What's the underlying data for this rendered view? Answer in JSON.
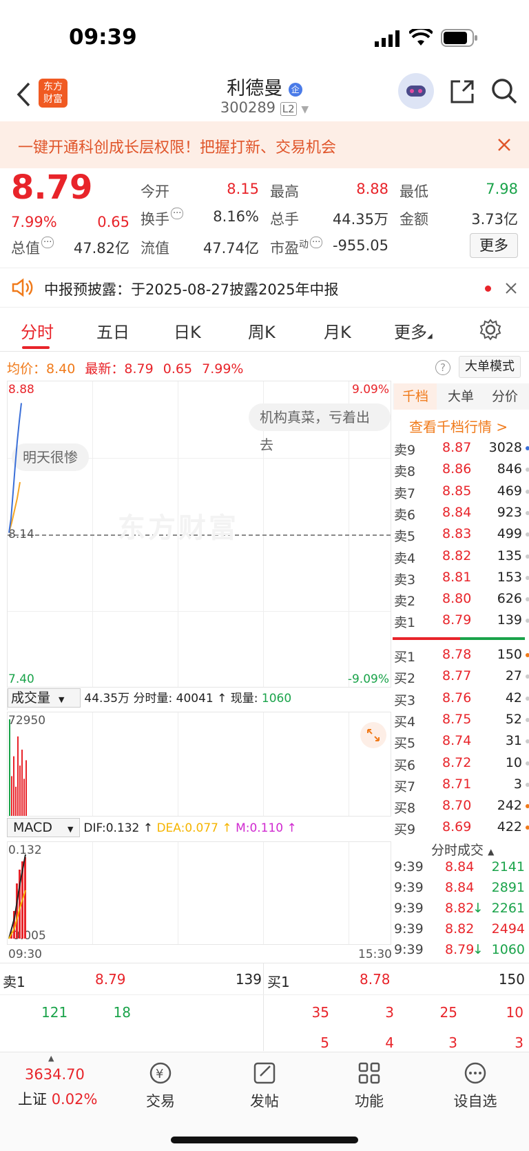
{
  "status_bar": {
    "time": "09:39"
  },
  "header": {
    "stock_name": "利德曼",
    "badge": "企",
    "stock_code": "300289",
    "level": "L2"
  },
  "banner": {
    "text": "一键开通科创成长层权限！把握打新、交易机会"
  },
  "quote": {
    "price": "8.79",
    "change_pct": "7.99%",
    "change": "0.65",
    "open_label": "今开",
    "open": "8.15",
    "high_label": "最高",
    "high": "8.88",
    "low_label": "最低",
    "low": "7.98",
    "turnover_label": "换手",
    "turnover": "8.16%",
    "volume_label": "总手",
    "volume": "44.35万",
    "amount_label": "金额",
    "amount": "3.73亿",
    "mktcap_label": "总值",
    "mktcap": "47.82亿",
    "float_label": "流值",
    "float": "47.74亿",
    "pe_label": "市盈",
    "pe_sup": "动",
    "pe": "-955.05",
    "more_button": "更多"
  },
  "notice": {
    "text": "中报预披露：于2025-08-27披露2025年中报"
  },
  "tabs": [
    "分时",
    "五日",
    "日K",
    "周K",
    "月K",
    "更多"
  ],
  "chart_info": {
    "avg_label": "均价：",
    "avg": "8.40",
    "latest_label": "最新：",
    "latest": "8.79",
    "latest_chg": "0.65",
    "latest_pct": "7.99%",
    "large_order_mode": "大单模式",
    "comment_1": "机构真菜，亏着出去",
    "comment_2": "明天很惨",
    "watermark": "东方财富"
  },
  "chart_data": {
    "type": "line",
    "y_top": "8.88",
    "y_mid": "8.14",
    "y_bottom": "7.40",
    "pct_top": "9.09%",
    "pct_bottom": "-9.09%",
    "x_start": "09:30",
    "x_end": "15:30",
    "price_series": {
      "values": [
        8.15,
        8.22,
        8.35,
        8.48,
        8.6,
        8.7,
        8.79
      ]
    },
    "avg_series": {
      "values": [
        8.15,
        8.2,
        8.26,
        8.32,
        8.4
      ]
    }
  },
  "volume_panel": {
    "selector": "成交量",
    "total": "44.35万",
    "minute_label": "分时量:",
    "minute": "40041",
    "current_label": "现量:",
    "current": "1060",
    "max": "72950",
    "bars": [
      72950,
      30000,
      45000,
      22000,
      60000,
      38000,
      50000,
      28000,
      42000
    ]
  },
  "macd_panel": {
    "selector": "MACD",
    "dif": "DIF:0.132",
    "dea": "DEA:0.077",
    "m": "M:0.110",
    "top": "0.132",
    "bottom": "-0.005"
  },
  "order_book": {
    "tabs": [
      "千档",
      "大单",
      "分价"
    ],
    "view_link": "查看千档行情 >",
    "asks": [
      {
        "label": "卖9",
        "price": "8.87",
        "vol": "3028",
        "dot": "#3a6fd8"
      },
      {
        "label": "卖8",
        "price": "8.86",
        "vol": "846",
        "dot": "#ccc"
      },
      {
        "label": "卖7",
        "price": "8.85",
        "vol": "469",
        "dot": "#ccc"
      },
      {
        "label": "卖6",
        "price": "8.84",
        "vol": "923",
        "dot": "#ccc"
      },
      {
        "label": "卖5",
        "price": "8.83",
        "vol": "499",
        "dot": "#ccc"
      },
      {
        "label": "卖4",
        "price": "8.82",
        "vol": "135",
        "dot": "#ccc"
      },
      {
        "label": "卖3",
        "price": "8.81",
        "vol": "153",
        "dot": "#ccc"
      },
      {
        "label": "卖2",
        "price": "8.80",
        "vol": "626",
        "dot": "#ccc"
      },
      {
        "label": "卖1",
        "price": "8.79",
        "vol": "139",
        "dot": "#ccc"
      }
    ],
    "bids": [
      {
        "label": "买1",
        "price": "8.78",
        "vol": "150",
        "dot": "#f07a1a"
      },
      {
        "label": "买2",
        "price": "8.77",
        "vol": "27",
        "dot": "#ccc"
      },
      {
        "label": "买3",
        "price": "8.76",
        "vol": "42",
        "dot": "#ccc"
      },
      {
        "label": "买4",
        "price": "8.75",
        "vol": "52",
        "dot": "#ccc"
      },
      {
        "label": "买5",
        "price": "8.74",
        "vol": "31",
        "dot": "#ccc"
      },
      {
        "label": "买6",
        "price": "8.72",
        "vol": "10",
        "dot": "#ccc"
      },
      {
        "label": "买7",
        "price": "8.71",
        "vol": "3",
        "dot": "#ccc"
      },
      {
        "label": "买8",
        "price": "8.70",
        "vol": "242",
        "dot": "#f07a1a"
      },
      {
        "label": "买9",
        "price": "8.69",
        "vol": "422",
        "dot": "#f07a1a"
      }
    ],
    "ticks_title": "分时成交",
    "ticks": [
      {
        "time": "9:39",
        "price": "8.84",
        "arrow": "",
        "vol": "2141",
        "color": "#1aa34a"
      },
      {
        "time": "9:39",
        "price": "8.84",
        "arrow": "",
        "vol": "2891",
        "color": "#1aa34a"
      },
      {
        "time": "9:39",
        "price": "8.82",
        "arrow": "↓",
        "vol": "2261",
        "color": "#1aa34a"
      },
      {
        "time": "9:39",
        "price": "8.82",
        "arrow": "",
        "vol": "2494",
        "color": "#e8242a"
      },
      {
        "time": "9:39",
        "price": "8.79",
        "arrow": "↓",
        "vol": "1060",
        "color": "#1aa34a"
      }
    ]
  },
  "queue": {
    "sell_label": "卖1",
    "sell_price": "8.79",
    "sell_vol": "139",
    "buy_label": "买1",
    "buy_price": "8.78",
    "buy_vol": "150",
    "sell_queue": [
      "121",
      "18"
    ],
    "buy_queue_row1": [
      "35",
      "3",
      "25",
      "10"
    ],
    "buy_queue_row2": [
      "5",
      "4",
      "3",
      "3"
    ]
  },
  "bottom_nav": {
    "index_value": "3634.70",
    "index_name": "上证",
    "index_pct": "0.02%",
    "items": [
      "交易",
      "发帖",
      "功能",
      "设自选"
    ]
  }
}
